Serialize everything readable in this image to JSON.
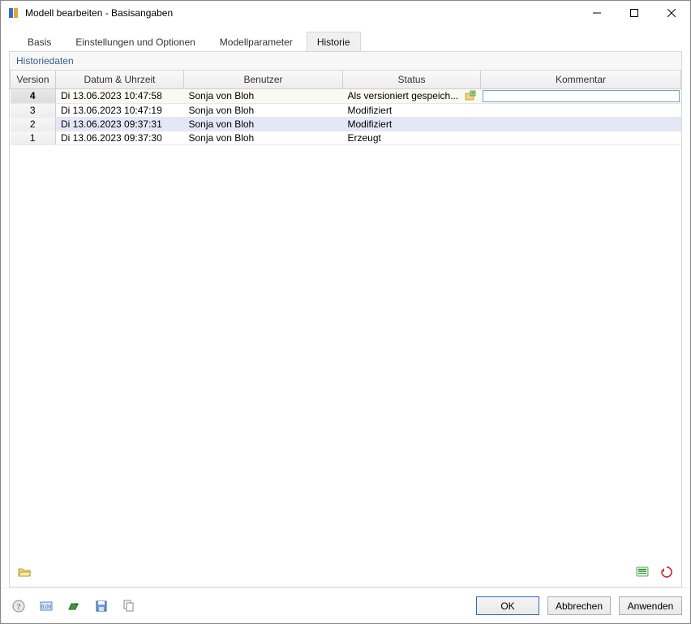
{
  "window": {
    "title": "Modell bearbeiten - Basisangaben"
  },
  "tabs": {
    "items": [
      {
        "label": "Basis"
      },
      {
        "label": "Einstellungen und Optionen"
      },
      {
        "label": "Modellparameter"
      },
      {
        "label": "Historie"
      }
    ],
    "active_index": 3
  },
  "panel": {
    "title": "Historiedaten"
  },
  "columns": {
    "version": "Version",
    "datetime": "Datum & Uhrzeit",
    "user": "Benutzer",
    "status": "Status",
    "comment": "Kommentar"
  },
  "rows": [
    {
      "version": "4",
      "datetime": "Di 13.06.2023 10:47:58",
      "user": "Sonja von Bloh",
      "status": "Als versioniert gespeich...",
      "comment": "",
      "has_icon": true,
      "current": true,
      "editing": true
    },
    {
      "version": "3",
      "datetime": "Di 13.06.2023 10:47:19",
      "user": "Sonja von Bloh",
      "status": "Modifiziert",
      "comment": ""
    },
    {
      "version": "2",
      "datetime": "Di 13.06.2023 09:37:31",
      "user": "Sonja von Bloh",
      "status": "Modifiziert",
      "comment": "",
      "selected": true
    },
    {
      "version": "1",
      "datetime": "Di 13.06.2023 09:37:30",
      "user": "Sonja von Bloh",
      "status": "Erzeugt",
      "comment": ""
    }
  ],
  "buttons": {
    "ok": "OK",
    "cancel": "Abbrechen",
    "apply": "Anwenden"
  }
}
